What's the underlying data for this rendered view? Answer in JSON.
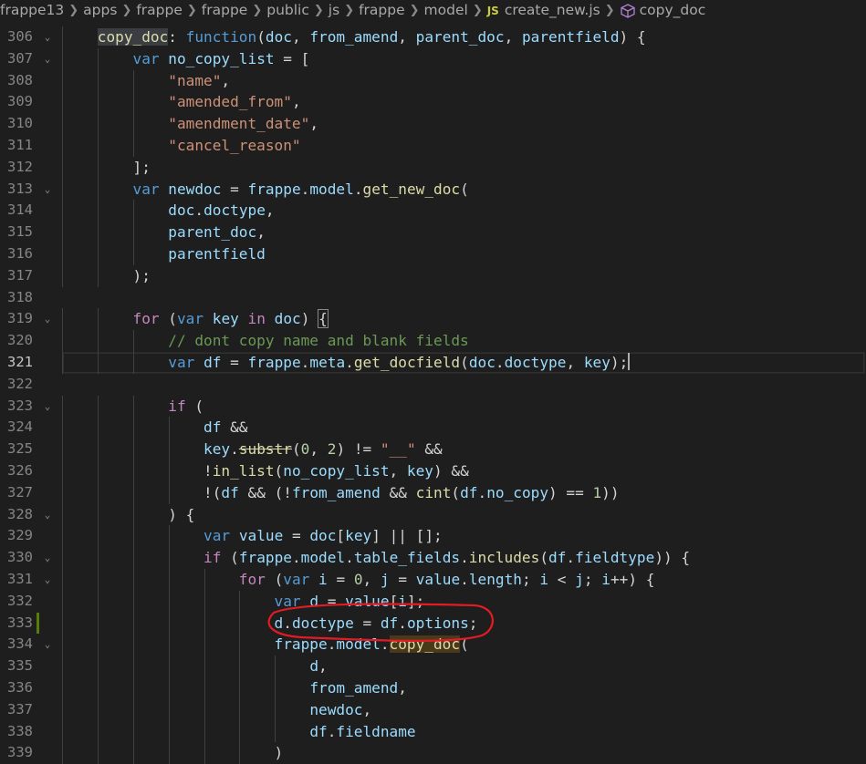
{
  "breadcrumb": {
    "items": [
      "frappe13",
      "apps",
      "frappe",
      "frappe",
      "public",
      "js",
      "frappe",
      "model"
    ],
    "file_icon": "JS",
    "file": "create_new.js",
    "symbol": "copy_doc"
  },
  "editor": {
    "language": "javascript",
    "active_line": 321,
    "modified_line": 333,
    "annotation_color": "#e51b24",
    "lines": [
      {
        "n": 306,
        "fold": true,
        "text": "    copy_doc: function(doc, from_amend, parent_doc, parentfield) {"
      },
      {
        "n": 307,
        "fold": true,
        "text": "        var no_copy_list = ["
      },
      {
        "n": 308,
        "fold": false,
        "text": "            \"name\","
      },
      {
        "n": 309,
        "fold": false,
        "text": "            \"amended_from\","
      },
      {
        "n": 310,
        "fold": false,
        "text": "            \"amendment_date\","
      },
      {
        "n": 311,
        "fold": false,
        "text": "            \"cancel_reason\""
      },
      {
        "n": 312,
        "fold": false,
        "text": "        ];"
      },
      {
        "n": 313,
        "fold": true,
        "text": "        var newdoc = frappe.model.get_new_doc("
      },
      {
        "n": 314,
        "fold": false,
        "text": "            doc.doctype,"
      },
      {
        "n": 315,
        "fold": false,
        "text": "            parent_doc,"
      },
      {
        "n": 316,
        "fold": false,
        "text": "            parentfield"
      },
      {
        "n": 317,
        "fold": false,
        "text": "        );"
      },
      {
        "n": 318,
        "fold": false,
        "text": ""
      },
      {
        "n": 319,
        "fold": true,
        "text": "        for (var key in doc) {"
      },
      {
        "n": 320,
        "fold": false,
        "text": "            // dont copy name and blank fields"
      },
      {
        "n": 321,
        "fold": false,
        "text": "            var df = frappe.meta.get_docfield(doc.doctype, key);"
      },
      {
        "n": 322,
        "fold": false,
        "text": ""
      },
      {
        "n": 323,
        "fold": true,
        "text": "            if ("
      },
      {
        "n": 324,
        "fold": false,
        "text": "                df &&"
      },
      {
        "n": 325,
        "fold": false,
        "text": "                key.substr(0, 2) != \"__\" &&"
      },
      {
        "n": 326,
        "fold": false,
        "text": "                !in_list(no_copy_list, key) &&"
      },
      {
        "n": 327,
        "fold": false,
        "text": "                !(df && (!from_amend && cint(df.no_copy) == 1))"
      },
      {
        "n": 328,
        "fold": true,
        "text": "            ) {"
      },
      {
        "n": 329,
        "fold": false,
        "text": "                var value = doc[key] || [];"
      },
      {
        "n": 330,
        "fold": true,
        "text": "                if (frappe.model.table_fields.includes(df.fieldtype)) {"
      },
      {
        "n": 331,
        "fold": true,
        "text": "                    for (var i = 0, j = value.length; i < j; i++) {"
      },
      {
        "n": 332,
        "fold": false,
        "text": "                        var d = value[i];"
      },
      {
        "n": 333,
        "fold": false,
        "text": "                        d.doctype = df.options;"
      },
      {
        "n": 334,
        "fold": true,
        "text": "                        frappe.model.copy_doc("
      },
      {
        "n": 335,
        "fold": false,
        "text": "                            d,"
      },
      {
        "n": 336,
        "fold": false,
        "text": "                            from_amend,"
      },
      {
        "n": 337,
        "fold": false,
        "text": "                            newdoc,"
      },
      {
        "n": 338,
        "fold": false,
        "text": "                            df.fieldname"
      },
      {
        "n": 339,
        "fold": false,
        "text": "                        )"
      }
    ]
  }
}
